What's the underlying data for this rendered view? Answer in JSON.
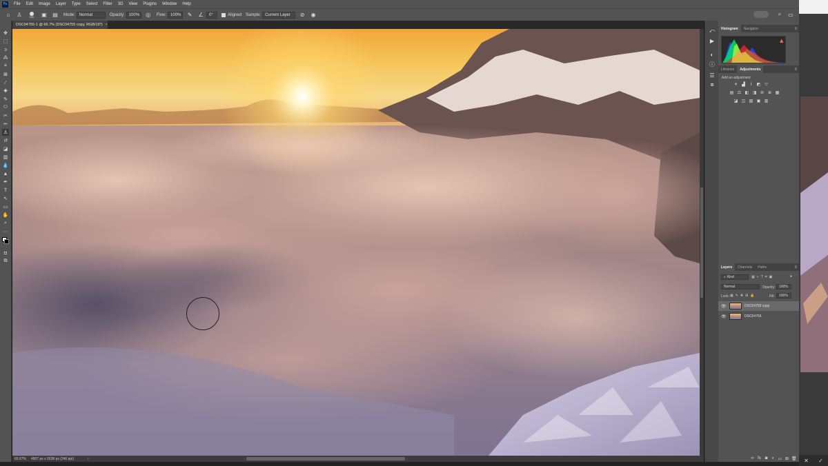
{
  "app": {
    "logo": "Ps"
  },
  "menu": [
    "File",
    "Edit",
    "Image",
    "Layer",
    "Type",
    "Select",
    "Filter",
    "3D",
    "View",
    "Plugins",
    "Window",
    "Help"
  ],
  "options": {
    "brush_size": "300",
    "mode_label": "Mode:",
    "mode_value": "Normal",
    "opacity_label": "Opacity:",
    "opacity_value": "100%",
    "flow_label": "Flow:",
    "flow_value": "100%",
    "angle_value": "0°",
    "aligned_label": "Aligned",
    "sample_label": "Sample:",
    "sample_value": "Current Layer"
  },
  "document": {
    "tab_title": "DSC04755-1 @ 66.7% (DSC04755 copy, RGB/16*)",
    "close": "×",
    "zoom": "66.67%",
    "dimensions": "4907 px x 5538 px (240 ppi)"
  },
  "panels": {
    "histogram_tab": "Histogram",
    "navigator_tab": "Navigator",
    "libraries_tab": "Libraries",
    "adjustments_tab": "Adjustments",
    "add_adjustment": "Add an adjustment",
    "layers_tab": "Layers",
    "channels_tab": "Channels",
    "paths_tab": "Paths",
    "kind_filter": "Kind",
    "blend_mode": "Normal",
    "opacity_label": "Opacity:",
    "opacity_value": "100%",
    "lock_label": "Lock:",
    "fill_label": "Fill:",
    "fill_value": "100%",
    "layers": [
      {
        "name": "DSC04755 copy",
        "selected": true
      },
      {
        "name": "DSC04755",
        "selected": false
      }
    ]
  },
  "colors": {
    "accent": "#31a8ff",
    "chrome": "#535353",
    "panel_dark": "#424242"
  }
}
